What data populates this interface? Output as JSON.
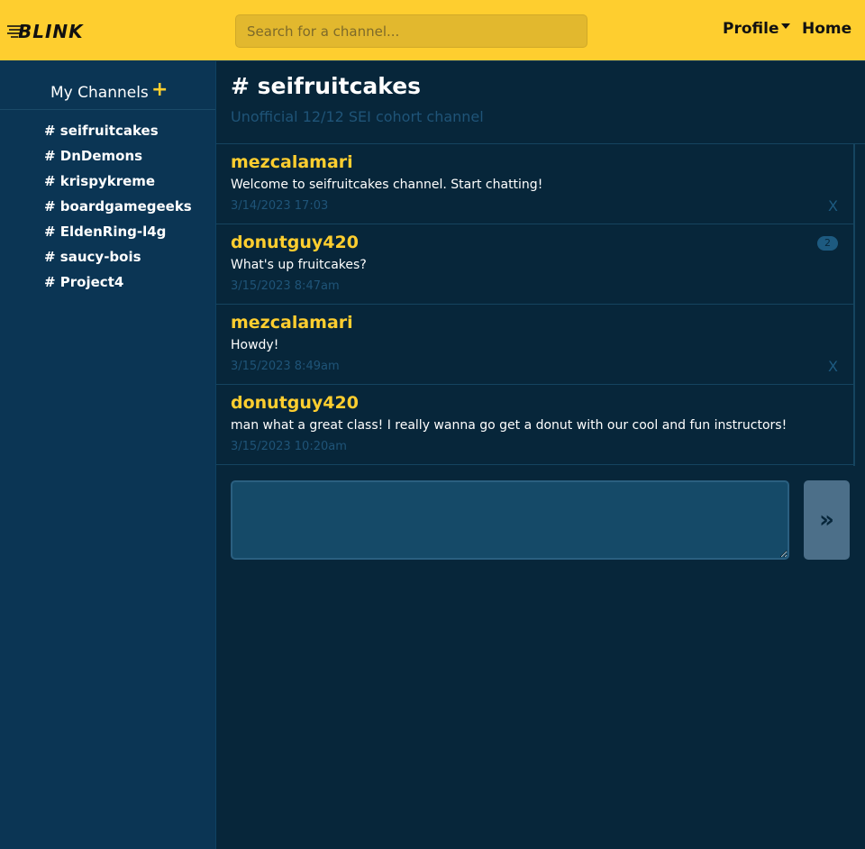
{
  "navbar": {
    "logo_text": "BLINK",
    "search_placeholder": "Search for a channel...",
    "profile_label": "Profile",
    "home_label": "Home"
  },
  "sidebar": {
    "title": "My Channels",
    "add_icon": "+",
    "channels": [
      "# seifruitcakes",
      "# DnDemons",
      "# krispykreme",
      "# boardgamegeeks",
      "# EldenRing-l4g",
      "# saucy-bois",
      "# Project4"
    ]
  },
  "channel": {
    "title": "# seifruitcakes",
    "description": "Unofficial 12/12 SEI cohort channel"
  },
  "messages": [
    {
      "user": "mezcalamari",
      "text": "Welcome to seifruitcakes channel. Start chatting!",
      "time": "3/14/2023 17:03",
      "delete": "X"
    },
    {
      "user": "donutguy420",
      "text": "What's up fruitcakes?",
      "time": "3/15/2023 8:47am",
      "badge": "2"
    },
    {
      "user": "mezcalamari",
      "text": "Howdy!",
      "time": "3/15/2023 8:49am",
      "delete": "X"
    },
    {
      "user": "donutguy420",
      "text": "man what a great class! I really wanna go get a donut with our cool and fun instructors!",
      "time": "3/15/2023 10:20am"
    }
  ],
  "compose": {
    "value": "",
    "send_icon": "»"
  },
  "colors": {
    "accent": "#fece2f",
    "background": "#07263a",
    "sidebar": "#0b3554"
  }
}
